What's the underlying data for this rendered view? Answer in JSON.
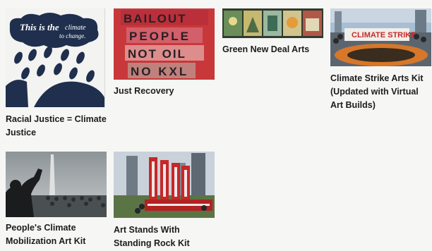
{
  "cards": [
    {
      "title": "Racial Justice = Climate Justice",
      "poster_text": [
        "This is the",
        "climate",
        "to change."
      ]
    },
    {
      "title": "Just Recovery",
      "poster_text": [
        "BAILOUT",
        "PEOPLE",
        "NOT OIL",
        "NO KXL"
      ]
    },
    {
      "title": "Green New Deal Arts"
    },
    {
      "title": "Climate Strike Arts Kit (Updated with Virtual Art Builds)",
      "banner_text": "CLIMATE STRIKE"
    },
    {
      "title": "People's Climate Mobilization Art Kit"
    },
    {
      "title": "Art Stands With Standing Rock Kit"
    }
  ],
  "colors": {
    "navy": "#1f2f4d",
    "red": "#c8383a",
    "text": "#1c1c1c",
    "page_bg": "#f6f6f4"
  }
}
